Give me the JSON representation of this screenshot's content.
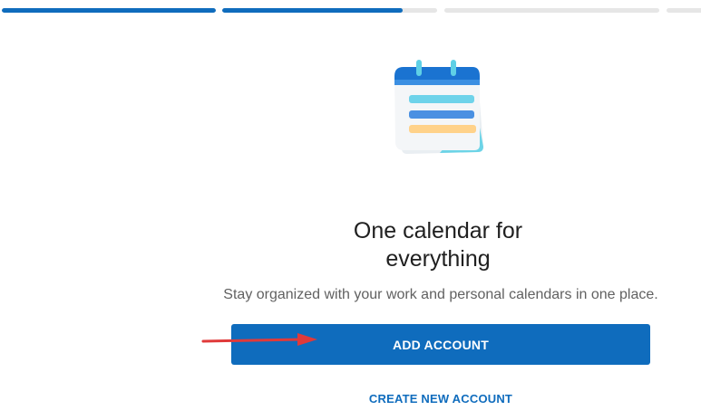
{
  "progress": {
    "steps": [
      {
        "fill": 1.0
      },
      {
        "fill": 0.84
      },
      {
        "fill": 0.0
      },
      {
        "fill": 0.0
      }
    ],
    "accent_color": "#0f6cbd",
    "track_color": "#e6e6e6"
  },
  "illustration": {
    "icon": "calendar-notepad-icon"
  },
  "heading": {
    "line1": "One calendar for",
    "line2": "everything"
  },
  "subtitle": "Stay organized with your work and personal calendars in one place.",
  "actions": {
    "add_account_label": "ADD ACCOUNT",
    "create_account_label": "CREATE NEW ACCOUNT"
  },
  "annotation": {
    "icon": "red-arrow-icon",
    "color": "#e03a3a"
  }
}
